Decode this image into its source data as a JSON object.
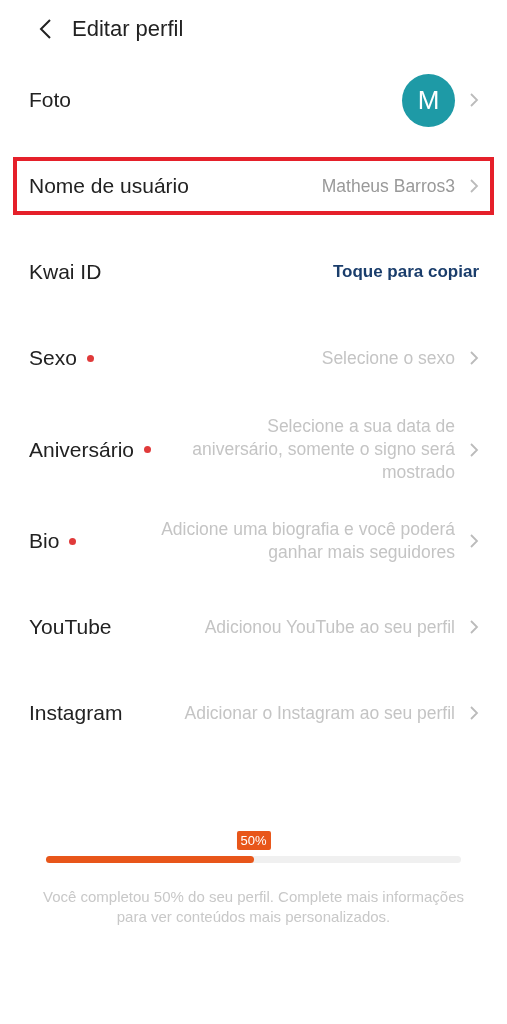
{
  "header": {
    "title": "Editar perfil"
  },
  "rows": [
    {
      "kind": "avatar",
      "label": "Foto",
      "avatar_letter": "M",
      "required": false,
      "highlighted": false
    },
    {
      "kind": "value",
      "label": "Nome de usuário",
      "value": "Matheus Barros3",
      "filled": true,
      "required": false,
      "highlighted": true
    },
    {
      "kind": "link",
      "label": "Kwai ID",
      "value": "Toque para copiar",
      "required": false,
      "highlighted": false
    },
    {
      "kind": "value",
      "label": "Sexo",
      "value": "Selecione o sexo",
      "filled": false,
      "required": true,
      "highlighted": false
    },
    {
      "kind": "value",
      "label": "Aniversário",
      "value": "Selecione a sua data de aniversário, somente o signo será mostrado",
      "filled": false,
      "required": true,
      "highlighted": false
    },
    {
      "kind": "value",
      "label": "Bio",
      "value": "Adicione uma biografia e você poderá ganhar mais seguidores",
      "filled": false,
      "required": true,
      "highlighted": false
    },
    {
      "kind": "value",
      "label": "YouTube",
      "value": "Adicionou YouTube ao seu perfil",
      "filled": false,
      "required": false,
      "highlighted": false
    },
    {
      "kind": "value",
      "label": "Instagram",
      "value": "Adicionar o Instagram ao seu perfil",
      "filled": false,
      "required": false,
      "highlighted": false
    }
  ],
  "progress": {
    "badge": "50%",
    "level": 0.5,
    "message": "Você completou 50% do seu perfil. Complete mais informações para ver conteúdos mais personalizados."
  }
}
